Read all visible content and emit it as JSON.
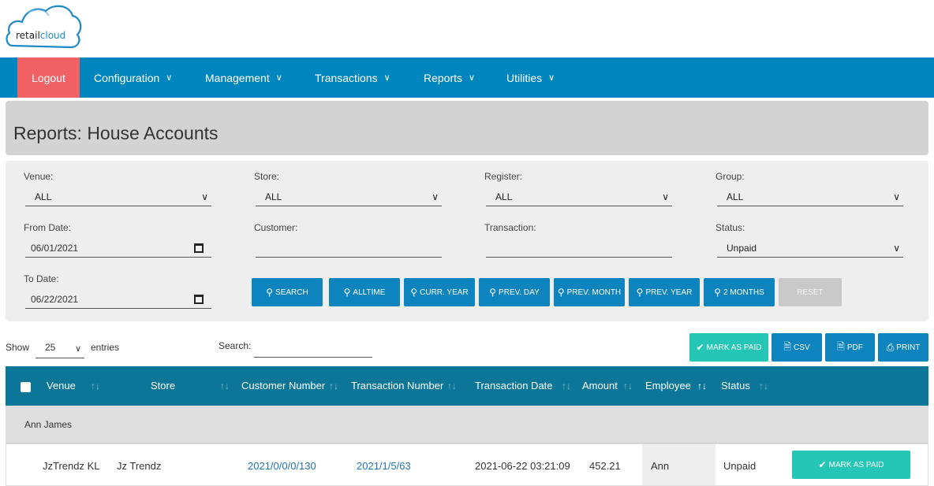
{
  "logo": {
    "text_a": "retail",
    "text_b": "cloud"
  },
  "nav": {
    "logout": "Logout",
    "items": [
      "Configuration",
      "Management",
      "Transactions",
      "Reports",
      "Utilities"
    ]
  },
  "page": {
    "title": "Reports: House Accounts"
  },
  "filters": {
    "venue": {
      "label": "Venue:",
      "value": "ALL"
    },
    "store": {
      "label": "Store:",
      "value": "ALL"
    },
    "register": {
      "label": "Register:",
      "value": "ALL"
    },
    "group": {
      "label": "Group:",
      "value": "ALL"
    },
    "from_date": {
      "label": "From Date:",
      "value": "06/01/2021"
    },
    "customer": {
      "label": "Customer:",
      "value": ""
    },
    "transaction": {
      "label": "Transaction:",
      "value": ""
    },
    "status": {
      "label": "Status:",
      "value": "Unpaid"
    },
    "to_date": {
      "label": "To Date:",
      "value": "06/22/2021"
    }
  },
  "buttons": {
    "search": "SEARCH",
    "alltime": "ALLTIME",
    "curr_year": "CURR. YEAR",
    "prev_day": "PREV. DAY",
    "prev_month": "PREV. MONTH",
    "prev_year": "PREV. YEAR",
    "two_months": "2 MONTHS",
    "reset": "RESET"
  },
  "table_controls": {
    "show": "Show",
    "entries_value": "25",
    "entries": "entries",
    "search_label": "Search:",
    "mark_as_paid": "MARK AS PAID",
    "csv": "CSV",
    "pdf": "PDF",
    "print": "PRINT"
  },
  "table": {
    "columns": [
      "Venue",
      "Store",
      "Customer Number",
      "Transaction Number",
      "Transaction Date",
      "Amount",
      "Employee",
      "Status"
    ],
    "group": "Ann James",
    "rows": [
      {
        "venue": "JzTrendz KL",
        "store": "Jz Trendz",
        "customer_number": "2021/0/0/0/130",
        "transaction_number": "2021/1/5/63",
        "transaction_date": "2021-06-22 03:21:09",
        "amount": "452.21",
        "employee": "Ann",
        "status": "Unpaid",
        "action": "MARK AS PAID"
      }
    ]
  },
  "colors": {
    "nav": "#0086bf",
    "logout": "#f26265",
    "table_header": "#0b7697",
    "button": "#0d84bd",
    "teal": "#26c6b7"
  }
}
